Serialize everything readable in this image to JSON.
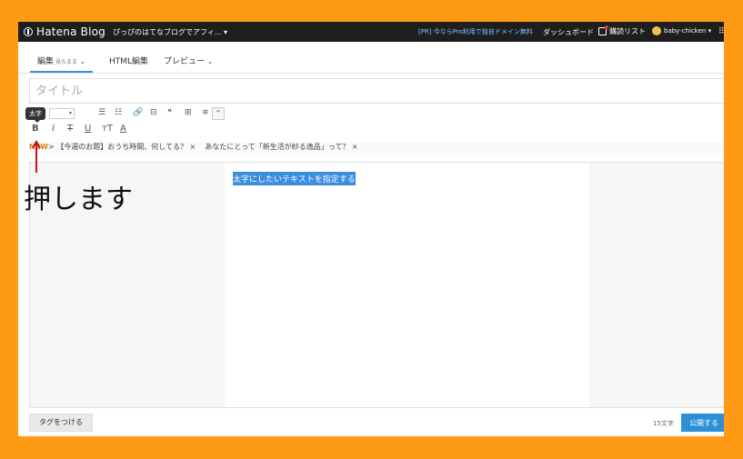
{
  "topbar": {
    "logo": "Hatena Blog",
    "blog_name": "ぴっぴのはてなブログでアフィ... ▾",
    "pr_text": "[PR] 今ならPro利用で独自ドメイン無料",
    "dashboard": "ダッシュボード",
    "reading_list": "購読リスト",
    "user": "baby-chicken ▾",
    "grid_icon": "grid-icon"
  },
  "tabs": {
    "edit": "編集",
    "edit_mode": "見たまま",
    "html": "HTML編集",
    "preview": "プレビュー"
  },
  "title_placeholder": "タイトル",
  "toolbar": {
    "tooltip": "太字",
    "select_arrow": "▾",
    "bold": "B",
    "italic": "i",
    "strike": "T",
    "underline": "U",
    "size": "тT",
    "color": "A"
  },
  "news": {
    "new_label": "NEW",
    "item1": "【今週のお題】おうち時間、何してる？",
    "item2": "あなたにとって「新生活が紗る逸品」って？"
  },
  "editor": {
    "selected_text": "太字にしたいテキストを指定する"
  },
  "annotation": "押します",
  "footer": {
    "tag_button": "タグをつける",
    "char_count": "15文字",
    "publish": "公開する"
  },
  "colors": {
    "frame": "#FF9A14",
    "accent": "#2e8fd8",
    "topbar": "#1e1e1e"
  }
}
